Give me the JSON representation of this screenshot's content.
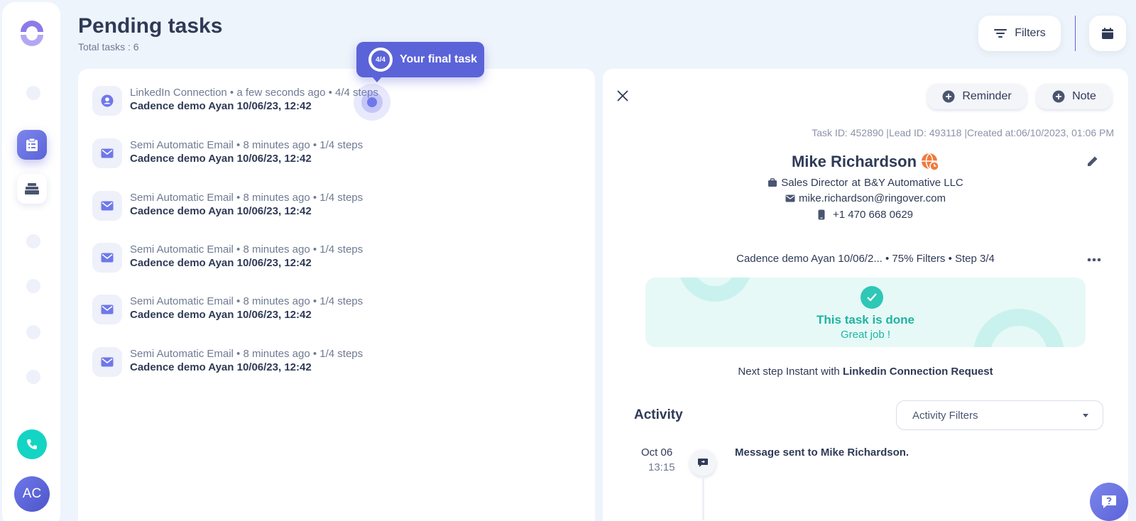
{
  "header": {
    "title": "Pending tasks",
    "total_tasks": "Total tasks : 6",
    "filters_label": "Filters"
  },
  "sidebar": {
    "avatar_initials": "AC",
    "icons": [
      "logo-icon",
      "clipboard-icon",
      "stack-icon",
      "phone-icon"
    ]
  },
  "tooltip": {
    "badge": "4/4",
    "text": "Your final task"
  },
  "tasks": [
    {
      "icon": "user-icon",
      "meta": "LinkedIn Connection • a few seconds ago • 4/4 steps",
      "name": "Cadence demo Ayan 10/06/23, 12:42"
    },
    {
      "icon": "mail-icon",
      "meta": "Semi Automatic Email • 8 minutes ago • 1/4 steps",
      "name": "Cadence demo Ayan 10/06/23, 12:42"
    },
    {
      "icon": "mail-icon",
      "meta": "Semi Automatic Email • 8 minutes ago • 1/4 steps",
      "name": "Cadence demo Ayan 10/06/23, 12:42"
    },
    {
      "icon": "mail-icon",
      "meta": "Semi Automatic Email • 8 minutes ago • 1/4 steps",
      "name": "Cadence demo Ayan 10/06/23, 12:42"
    },
    {
      "icon": "mail-icon",
      "meta": "Semi Automatic Email • 8 minutes ago • 1/4 steps",
      "name": "Cadence demo Ayan 10/06/23, 12:42"
    },
    {
      "icon": "mail-icon",
      "meta": "Semi Automatic Email • 8 minutes ago • 1/4 steps",
      "name": "Cadence demo Ayan 10/06/23, 12:42"
    }
  ],
  "detail": {
    "reminder_label": "Reminder",
    "note_label": "Note",
    "ids_line": "Task ID: 452890 |Lead ID: 493118 |Created at:06/10/2023, 01:06 PM",
    "lead_name": "Mike Richardson",
    "job_title": "Sales Director",
    "at": "at",
    "company": "B&Y Automative LLC",
    "email": "mike.richardson@ringover.com",
    "phone": "+1 470 668 0629",
    "cadence_line": "Cadence demo Ayan 10/06/2... • 75% Filters • Step 3/4",
    "done_title": "This task is done",
    "done_sub": "Great job !",
    "next_step_prefix": "Next step Instant with ",
    "next_step_bold": "Linkedin Connection Request",
    "activity_title": "Activity",
    "activity_filter": "Activity Filters",
    "activity": {
      "date": "Oct 06",
      "time": "13:15",
      "text": "Message sent to Mike Richardson."
    }
  },
  "colors": {
    "accent": "#5b63d8",
    "success": "#1fb3a3",
    "call": "#14d4c3",
    "background": "#eef4fb"
  }
}
